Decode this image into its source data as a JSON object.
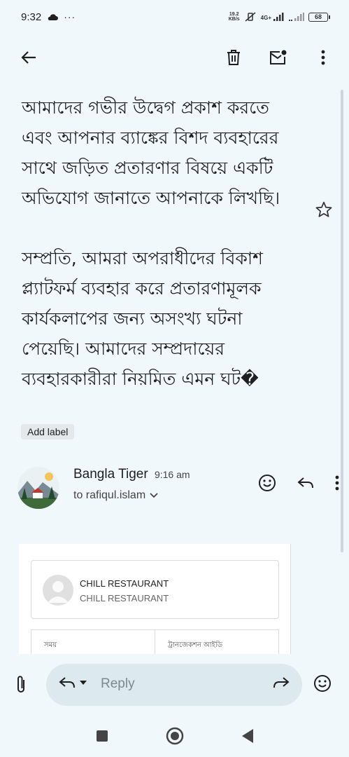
{
  "status_bar": {
    "time": "9:32",
    "net_speed_value": "19.2",
    "net_speed_unit": "KB/s",
    "network": "4G+",
    "battery": "68"
  },
  "toolbar": {
    "back_icon": "arrow-left-icon",
    "delete_icon": "trash-icon",
    "mark_unread_icon": "mail-unread-icon",
    "more_icon": "more-vert-icon"
  },
  "email": {
    "paragraph1": "আমাদের গভীর উদ্বেগ প্রকাশ করতে এবং আপনার ব্যাঙ্কের বিশদ ব্যবহারের সাথে জড়িত প্রতারণার বিষয়ে একটি অভিযোগ জানাতে আপনাকে লিখছি।",
    "paragraph2": "সম্প্রতি, আমরা অপরাধীদের বিকাশ প্ল্যাটফর্ম ব্যবহার করে প্রতারণামূলক কার্যকলাপের জন্য অসংখ্য ঘটনা পেয়েছি। আমাদের সম্প্রদায়ের ব্যবহারকারীরা নিয়মিত এমন ঘট�",
    "add_label": "Add label"
  },
  "sender": {
    "name": "Bangla Tiger",
    "time": "9:16 am",
    "to": "to rafiqul.islam"
  },
  "card": {
    "title": "CHILL RESTAURANT",
    "subtitle": "CHILL RESTAURANT",
    "col1": "সময়",
    "col2": "ট্রানজেকশন আইডি"
  },
  "reply": {
    "placeholder": "Reply"
  },
  "colors": {
    "background": "#f0f8fb",
    "reply_pill": "#dce9ee",
    "text": "#1f1f1f"
  }
}
